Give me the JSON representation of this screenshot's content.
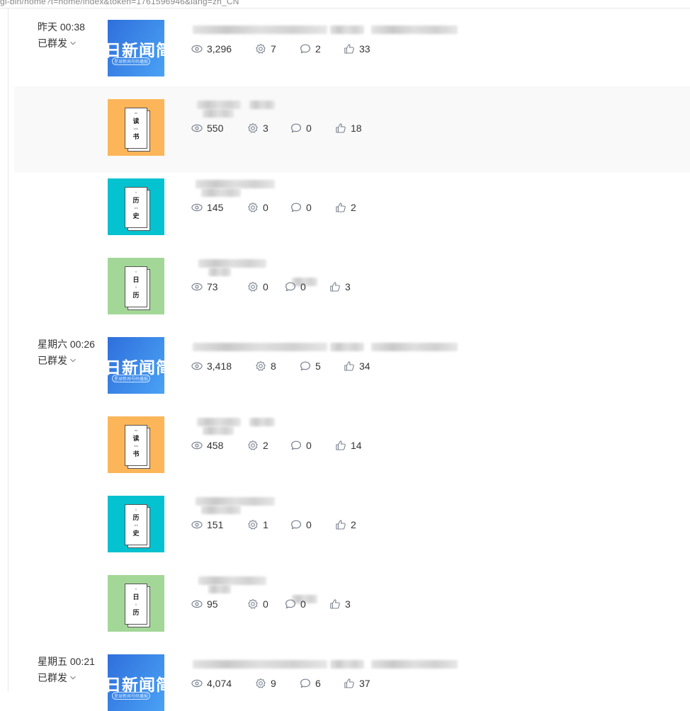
{
  "browser": {
    "url_fragment": "gi-bin/home?t=home/index&token=1761596946&lang=zh_CN"
  },
  "groups": [
    {
      "date": "昨天 00:38",
      "status": "已群发",
      "items": [
        {
          "thumb": "news",
          "stats": {
            "reads": "3,296",
            "shares": "7",
            "comments": "2",
            "likes": "33"
          }
        },
        {
          "thumb": "reading",
          "stats": {
            "reads": "550",
            "shares": "3",
            "comments": "0",
            "likes": "18"
          }
        },
        {
          "thumb": "history",
          "stats": {
            "reads": "145",
            "shares": "0",
            "comments": "0",
            "likes": "2"
          }
        },
        {
          "thumb": "calendar",
          "stats": {
            "reads": "73",
            "shares": "0",
            "comments": "0",
            "likes": "3"
          }
        }
      ]
    },
    {
      "date": "星期六 00:26",
      "status": "已群发",
      "items": [
        {
          "thumb": "news",
          "stats": {
            "reads": "3,418",
            "shares": "8",
            "comments": "5",
            "likes": "34"
          }
        },
        {
          "thumb": "reading",
          "stats": {
            "reads": "458",
            "shares": "2",
            "comments": "0",
            "likes": "14"
          }
        },
        {
          "thumb": "history",
          "stats": {
            "reads": "151",
            "shares": "1",
            "comments": "0",
            "likes": "2"
          }
        },
        {
          "thumb": "calendar",
          "stats": {
            "reads": "95",
            "shares": "0",
            "comments": "0",
            "likes": "3"
          }
        }
      ]
    },
    {
      "date": "星期五 00:21",
      "status": "已群发",
      "items": [
        {
          "thumb": "news",
          "stats": {
            "reads": "4,074",
            "shares": "9",
            "comments": "6",
            "likes": "37"
          }
        }
      ]
    }
  ],
  "thumbnails": {
    "news": {
      "text": "日新闻简",
      "caption": "星球新闻号码播报",
      "color": "#3584e8"
    },
    "reading": {
      "glyphs": [
        "读",
        "书"
      ],
      "pinyin": [
        "dú",
        "shū"
      ],
      "color": "#fcb659"
    },
    "history": {
      "glyphs": [
        "历",
        "史"
      ],
      "pinyin": [
        "lì",
        "shǐ"
      ],
      "color": "#04c2cf"
    },
    "calendar": {
      "glyphs": [
        "日",
        "历"
      ],
      "pinyin": [
        "rì",
        "lì"
      ],
      "color": "#a3d797"
    }
  },
  "icons": {
    "reads": "eye-icon",
    "shares": "share-gear-icon",
    "comments": "comment-icon",
    "likes": "thumbs-up-icon",
    "status_toggle": "chevron-down-icon"
  },
  "colors": {
    "text": "#333333",
    "icon": "#7a8290",
    "hover_row": "#f9f9f9"
  }
}
